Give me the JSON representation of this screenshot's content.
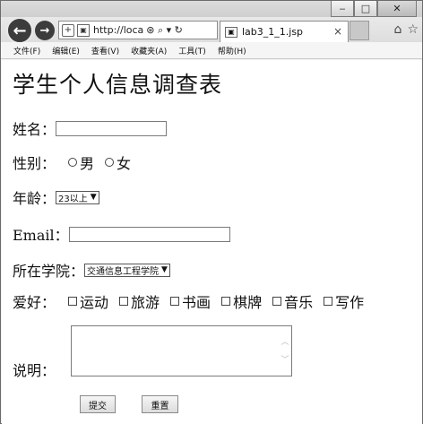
{
  "window": {
    "minimize": "‒",
    "maximize": "□",
    "close": "✕"
  },
  "toolbar": {
    "back": "←",
    "forward": "→",
    "address_plus": "+",
    "address_text": "http://loca",
    "address_tools": "⊛ ⌕ ▾ ↻",
    "tab_title": "lab3_1_1.jsp",
    "tab_close": "×",
    "home": "⌂",
    "favorites": "☆"
  },
  "menu": [
    "文件(F)",
    "编辑(E)",
    "查看(V)",
    "收藏夹(A)",
    "工具(T)",
    "帮助(H)"
  ],
  "form": {
    "title": "学生个人信息调查表",
    "name_label": "姓名：",
    "gender_label": "性别：",
    "gender_options": [
      "男",
      "女"
    ],
    "age_label": "年龄：",
    "age_selected": "23以上",
    "email_label": "Email：",
    "college_label": "所在学院：",
    "college_selected": "交通信息工程学院",
    "hobby_label": "爱好：",
    "hobbies": [
      "运动",
      "旅游",
      "书画",
      "棋牌",
      "音乐",
      "写作"
    ],
    "desc_label": "说明：",
    "submit": "提交",
    "reset": "重置"
  }
}
